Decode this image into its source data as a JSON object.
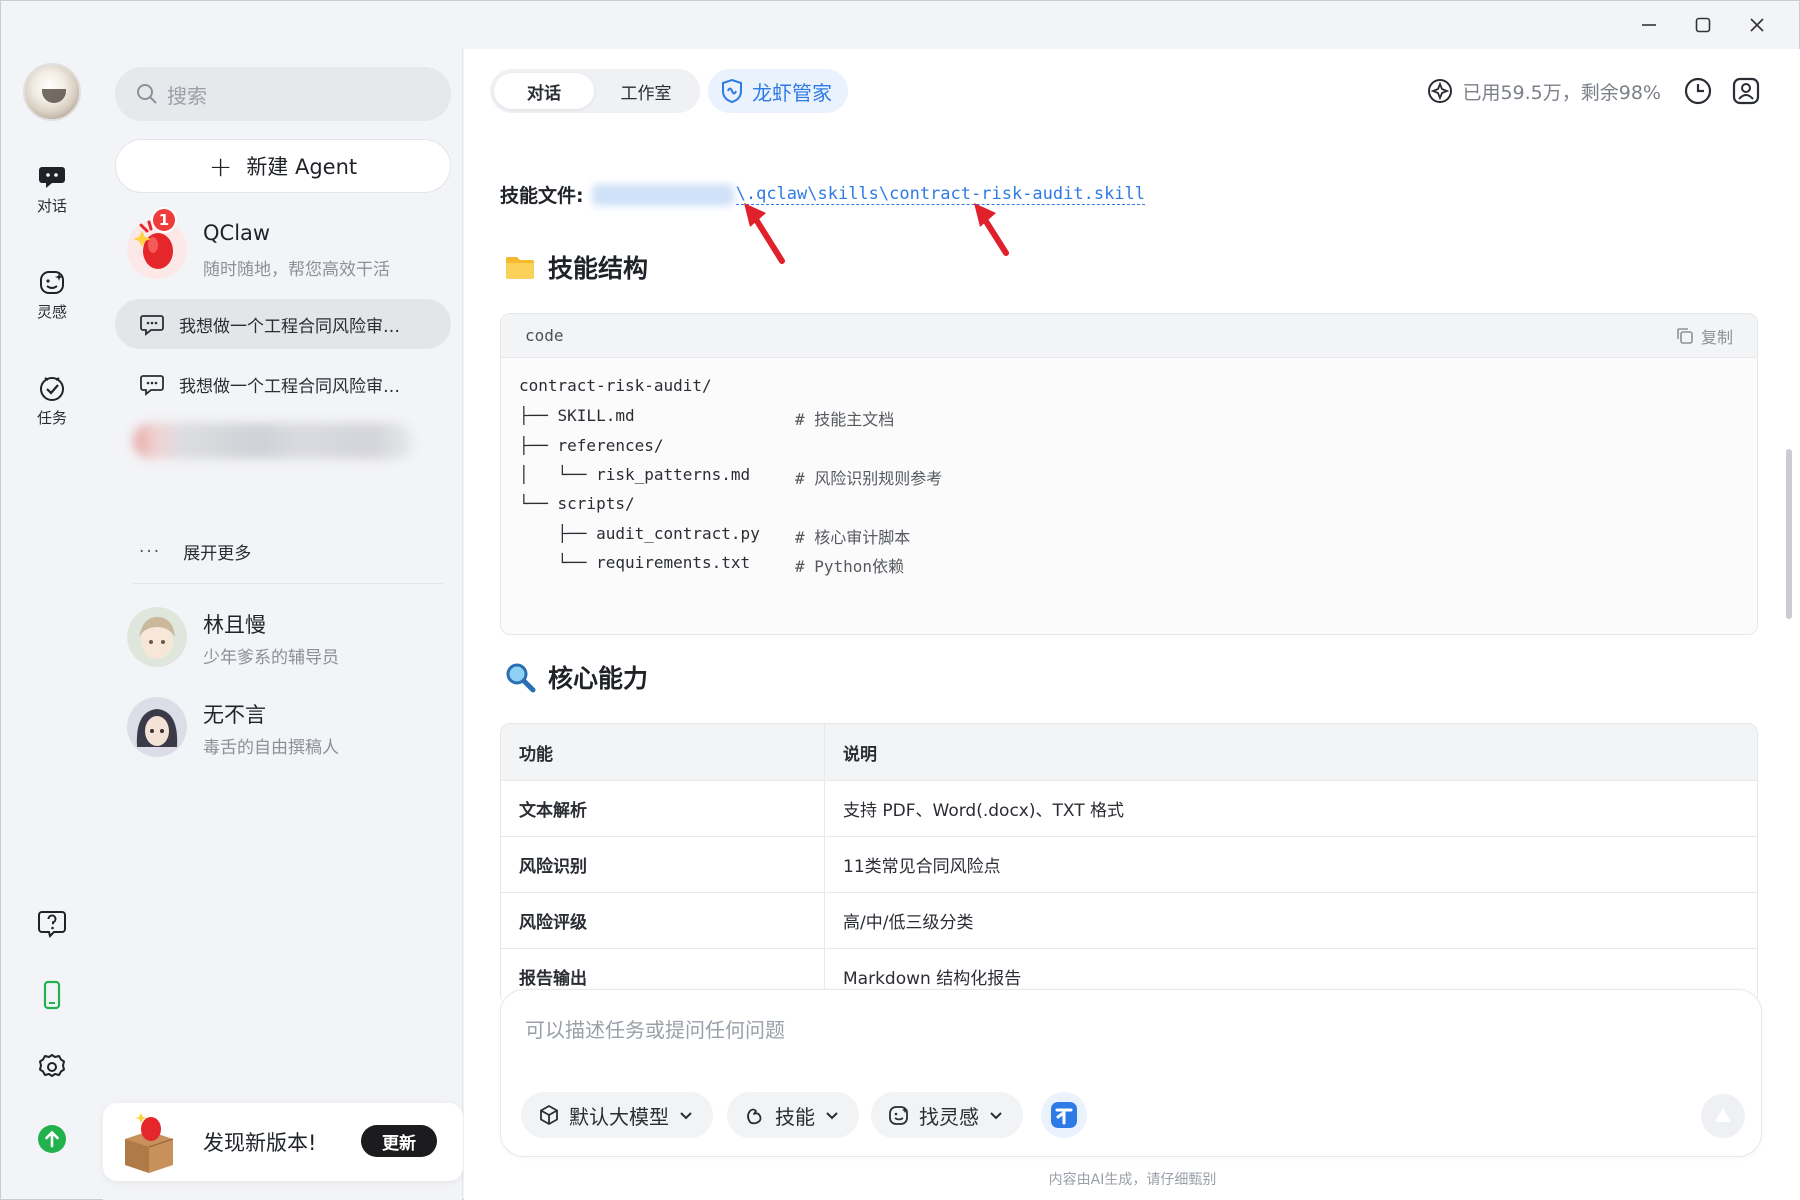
{
  "window": {
    "min": "minimize",
    "max": "maximize",
    "close": "close"
  },
  "rail": {
    "items": [
      {
        "label": "对话",
        "icon": "chat-bubble-icon"
      },
      {
        "label": "灵感",
        "icon": "sparkle-face-icon"
      },
      {
        "label": "任务",
        "icon": "check-circle-icon"
      }
    ],
    "bottom": [
      "help-icon",
      "phone-icon",
      "settings-icon",
      "upgrade-icon"
    ]
  },
  "sidebar": {
    "search_placeholder": "搜索",
    "new_agent": "新建 Agent",
    "qclaw": {
      "name": "QClaw",
      "desc": "随时随地，帮您高效干活",
      "badge": "1"
    },
    "chats": [
      {
        "title": "我想做一个工程合同风险审…"
      },
      {
        "title": "我想做一个工程合同风险审…"
      }
    ],
    "more": "展开更多",
    "agents": [
      {
        "name": "林且慢",
        "desc": "少年爹系的辅导员"
      },
      {
        "name": "无不言",
        "desc": "毒舌的自由撰稿人"
      }
    ],
    "update": {
      "text": "发现新版本!",
      "button": "更新"
    }
  },
  "main": {
    "tabs": [
      {
        "label": "对话"
      },
      {
        "label": "工作室"
      }
    ],
    "butler": "龙虾管家",
    "usage": "已用59.5万，剩余98%",
    "skill_file": {
      "label": "技能文件:",
      "path": "\\.qclaw\\skills\\contract-risk-audit.skill"
    },
    "section1": "技能结构",
    "code": {
      "lang": "code",
      "copy": "复制",
      "lines": [
        {
          "text": "contract-risk-audit/",
          "comment": ""
        },
        {
          "text": "├── SKILL.md",
          "comment": "# 技能主文档"
        },
        {
          "text": "├── references/",
          "comment": ""
        },
        {
          "text": "│   └── risk_patterns.md",
          "comment": "# 风险识别规则参考"
        },
        {
          "text": "└── scripts/",
          "comment": ""
        },
        {
          "text": "    ├── audit_contract.py",
          "comment": "# 核心审计脚本"
        },
        {
          "text": "    └── requirements.txt",
          "comment": "# Python依赖"
        }
      ]
    },
    "section2": "核心能力",
    "table": {
      "headers": [
        "功能",
        "说明"
      ],
      "rows": [
        [
          "文本解析",
          "支持 PDF、Word(.docx)、TXT 格式"
        ],
        [
          "风险识别",
          "11类常见合同风险点"
        ],
        [
          "风险评级",
          "高/中/低三级分类"
        ],
        [
          "报告输出",
          "Markdown 结构化报告"
        ]
      ]
    },
    "composer": {
      "placeholder": "可以描述任务或提问任何问题",
      "chips": [
        "默认大模型",
        "技能",
        "找灵感"
      ]
    },
    "disclaimer": "内容由AI生成，请仔细甄别"
  },
  "colors": {
    "accent": "#2f7be6",
    "badge": "#ef3b3b",
    "arrow": "#e0202a",
    "upgrade": "#22b14c"
  }
}
